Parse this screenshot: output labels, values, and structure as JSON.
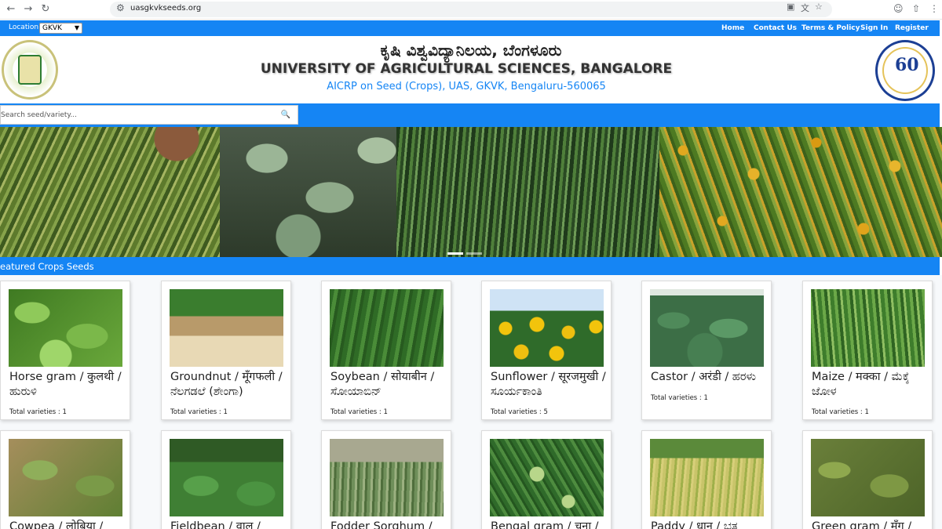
{
  "browser": {
    "url": "uasgkvkseeds.org"
  },
  "topbar": {
    "location_label": "Location:",
    "location_value": "GKVK",
    "nav": [
      "Home",
      "Contact Us",
      "Terms & Policy",
      "Sign In",
      "Register"
    ]
  },
  "header": {
    "title_kannada": "ಕೃಷಿ ವಿಶ್ವವಿದ್ಯಾನಿಲಯ, ಬೆಂಗಳೂರು",
    "title_english": "UNIVERSITY OF AGRICULTURAL SCIENCES, BANGALORE",
    "subtitle": "AICRP on Seed (Crops), UAS, GKVK, Bengaluru-560065"
  },
  "search": {
    "placeholder": "Search seed/variety..."
  },
  "section": {
    "title": "eatured Crops Seeds"
  },
  "crops_row1": [
    {
      "name": "Horse gram / कुलथी / ಹುರುಳಿ",
      "count": "Total varieties : 1"
    },
    {
      "name": "Groundnut / मूँगफली / ನೆಲಗಡಲೆ (ಶೇಂಗಾ)",
      "count": "Total varieties : 1"
    },
    {
      "name": "Soybean / सोयाबीन / ಸೋಯಾಬಿನ್",
      "count": "Total varieties : 1"
    },
    {
      "name": "Sunflower / सूरजमुखी / ಸೂರ್ಯಕಾಂತಿ",
      "count": "Total varieties : 5"
    },
    {
      "name": "Castor / अरंडी / ಹರಳು",
      "count": "Total varieties : 1"
    },
    {
      "name": "Maize / मक्का / ಮೆಕ್ಕೆ ಜೋಳ",
      "count": "Total varieties : 1"
    }
  ],
  "crops_row2": [
    {
      "name": "Cowpea / लोबिया /"
    },
    {
      "name": "Fieldbean / वाल /"
    },
    {
      "name": "Fodder Sorghum /"
    },
    {
      "name": "Bengal gram / चना /"
    },
    {
      "name": "Paddy / धान / ಭತ್ತ"
    },
    {
      "name": "Green gram / मूँग /"
    }
  ]
}
